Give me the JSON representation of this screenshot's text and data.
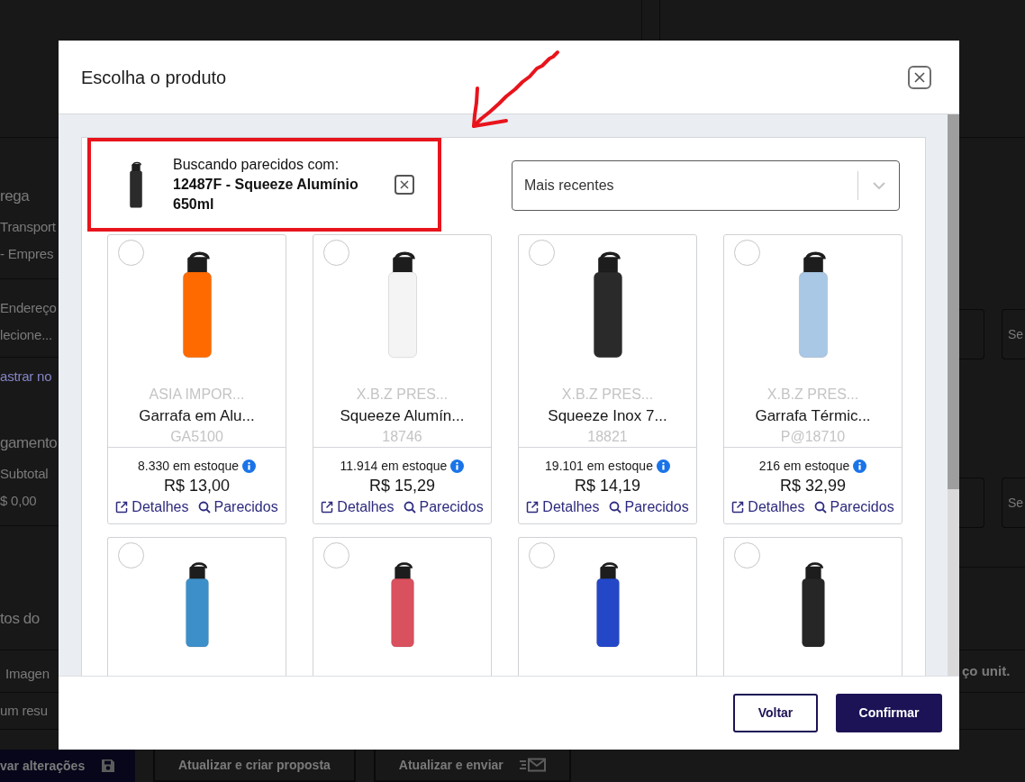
{
  "background_page": {
    "left_panel": [
      {
        "heading": "rega",
        "lines": [
          "Transport",
          "- Empres"
        ]
      },
      {
        "lines": [
          "Endereço",
          "lecione..."
        ]
      },
      {
        "link": "astrar no"
      },
      {
        "heading": "gamento",
        "lines": [
          "Subtotal",
          "$ 0,00"
        ]
      },
      {
        "heading": "tos do"
      },
      {
        "lines": [
          "Imagen"
        ]
      },
      {
        "lines": [
          "um resu"
        ]
      }
    ],
    "right_panel": {
      "field_rows": [
        {
          "placeholder": "Se"
        },
        {
          "placeholder": "Se"
        }
      ],
      "table_header": "ço unit."
    },
    "action_bar": [
      {
        "label": "var alterações",
        "kind": "primary"
      },
      {
        "label": "Atualizar e criar proposta",
        "kind": "outline"
      },
      {
        "label": "Atualizar e enviar",
        "kind": "outline"
      }
    ]
  },
  "modal": {
    "title": "Escolha o produto",
    "search_reference": {
      "label": "Buscando parecidos com:",
      "product": "12487F - Squeeze Alumínio 650ml",
      "highlighted": true
    },
    "sort": {
      "value": "Mais recentes"
    },
    "products": [
      {
        "selected": false,
        "color": "#ff6a00",
        "vendor": "ASIA IMPOR...",
        "name": "Garrafa em Alu...",
        "code": "GA5100",
        "stock": "8.330 em estoque",
        "price": "R$ 13,00",
        "details_link": "Detalhes",
        "similar_link": "Parecidos"
      },
      {
        "selected": false,
        "color": "#f4f4f4",
        "vendor": "X.B.Z PRES...",
        "name": "Squeeze Alumín...",
        "code": "18746",
        "stock": "11.914 em estoque",
        "price": "R$ 15,29",
        "details_link": "Detalhes",
        "similar_link": "Parecidos"
      },
      {
        "selected": false,
        "color": "#2a2a2a",
        "vendor": "X.B.Z PRES...",
        "name": "Squeeze Inox 7...",
        "code": "18821",
        "stock": "19.101 em estoque",
        "price": "R$ 14,19",
        "details_link": "Detalhes",
        "similar_link": "Parecidos"
      },
      {
        "selected": false,
        "color": "#a9c8e6",
        "vendor": "X.B.Z PRES...",
        "name": "Garrafa Térmic...",
        "code": "P@18710",
        "stock": "216 em estoque",
        "price": "R$ 32,99",
        "details_link": "Detalhes",
        "similar_link": "Parecidos"
      },
      {
        "selected": false,
        "color": "#3d8fc9"
      },
      {
        "selected": false,
        "color": "#d9505e"
      },
      {
        "selected": false,
        "color": "#2447c8"
      },
      {
        "selected": false,
        "color": "#262626"
      }
    ],
    "buttons": [
      {
        "label": "Voltar",
        "kind": "outline"
      },
      {
        "label": "Confirmar",
        "kind": "primary"
      }
    ]
  },
  "annotations": [
    {
      "kind": "arrow"
    }
  ]
}
